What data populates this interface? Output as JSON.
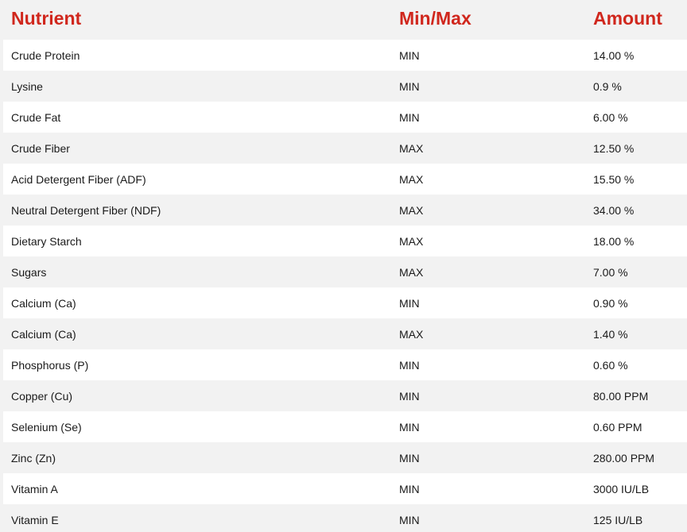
{
  "headers": {
    "nutrient": "Nutrient",
    "minmax": "Min/Max",
    "amount": "Amount"
  },
  "rows": [
    {
      "nutrient": "Crude Protein",
      "minmax": "MIN",
      "amount": "14.00 %"
    },
    {
      "nutrient": "Lysine",
      "minmax": "MIN",
      "amount": "0.9 %"
    },
    {
      "nutrient": "Crude Fat",
      "minmax": "MIN",
      "amount": "6.00 %"
    },
    {
      "nutrient": "Crude Fiber",
      "minmax": "MAX",
      "amount": "12.50 %"
    },
    {
      "nutrient": "Acid Detergent Fiber (ADF)",
      "minmax": "MAX",
      "amount": "15.50 %"
    },
    {
      "nutrient": "Neutral Detergent Fiber (NDF)",
      "minmax": "MAX",
      "amount": "34.00 %"
    },
    {
      "nutrient": "Dietary Starch",
      "minmax": "MAX",
      "amount": "18.00 %"
    },
    {
      "nutrient": "Sugars",
      "minmax": "MAX",
      "amount": "7.00 %"
    },
    {
      "nutrient": "Calcium (Ca)",
      "minmax": "MIN",
      "amount": "0.90 %"
    },
    {
      "nutrient": "Calcium (Ca)",
      "minmax": "MAX",
      "amount": "1.40 %"
    },
    {
      "nutrient": "Phosphorus (P)",
      "minmax": "MIN",
      "amount": "0.60 %"
    },
    {
      "nutrient": "Copper (Cu)",
      "minmax": "MIN",
      "amount": "80.00 PPM"
    },
    {
      "nutrient": "Selenium (Se)",
      "minmax": "MIN",
      "amount": "0.60 PPM"
    },
    {
      "nutrient": "Zinc (Zn)",
      "minmax": "MIN",
      "amount": "280.00 PPM"
    },
    {
      "nutrient": "Vitamin A",
      "minmax": "MIN",
      "amount": "3000 IU/LB"
    },
    {
      "nutrient": "Vitamin E",
      "minmax": "MIN",
      "amount": "125 IU/LB"
    }
  ],
  "colors": {
    "header_text": "#d0271d",
    "row_odd": "#ffffff",
    "row_even": "#f2f2f2"
  }
}
